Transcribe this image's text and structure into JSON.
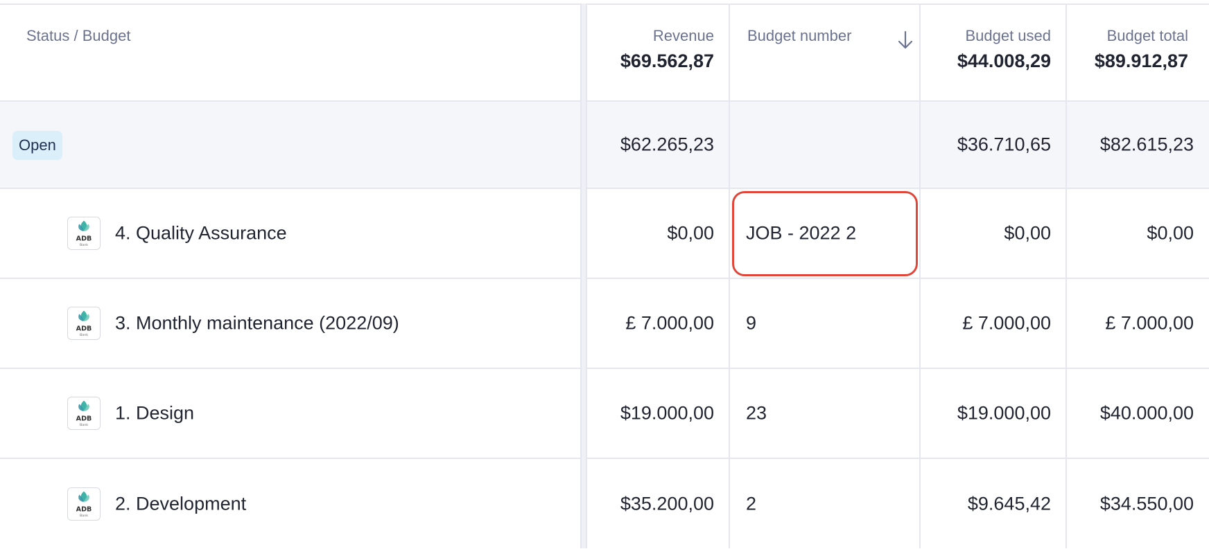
{
  "header": {
    "status_budget": "Status / Budget",
    "revenue_label": "Revenue",
    "revenue_total": "$69.562,87",
    "budget_number_label": "Budget number",
    "budget_used_label": "Budget used",
    "budget_used_total": "$44.008,29",
    "budget_total_label": "Budget total",
    "budget_total_total": "$89.912,87",
    "sort_icon": "arrow-down-icon"
  },
  "group": {
    "status": "Open",
    "revenue": "$62.265,23",
    "budget_number": "",
    "budget_used": "$36.710,65",
    "budget_total": "$82.615,23"
  },
  "rows": [
    {
      "name": "4. Quality Assurance",
      "revenue": "$0,00",
      "budget_number": "JOB - 2022 2",
      "budget_used": "$0,00",
      "budget_total": "$0,00",
      "logo_text": "ADB",
      "logo_sub": "Bank"
    },
    {
      "name": "3. Monthly maintenance (2022/09)",
      "revenue": "£ 7.000,00",
      "budget_number": "9",
      "budget_used": "£ 7.000,00",
      "budget_total": "£ 7.000,00",
      "logo_text": "ADB",
      "logo_sub": "Bank"
    },
    {
      "name": "1. Design",
      "revenue": "$19.000,00",
      "budget_number": "23",
      "budget_used": "$19.000,00",
      "budget_total": "$40.000,00",
      "logo_text": "ADB",
      "logo_sub": "Bank"
    },
    {
      "name": "2. Development",
      "revenue": "$35.200,00",
      "budget_number": "2",
      "budget_used": "$9.645,42",
      "budget_total": "$34.550,00",
      "logo_text": "ADB",
      "logo_sub": "Bank"
    }
  ],
  "colors": {
    "badge_bg": "#dbeffb",
    "highlight": "#e0473a",
    "header_label": "#6b7290"
  }
}
